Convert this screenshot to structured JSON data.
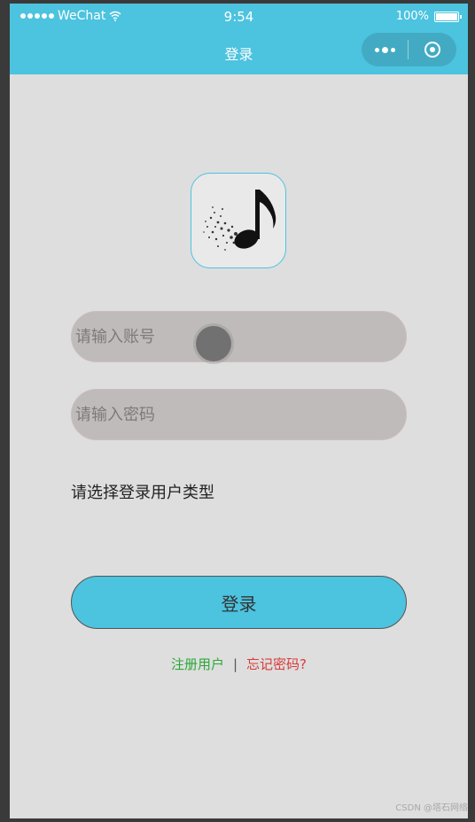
{
  "status_bar": {
    "carrier": "WeChat",
    "time": "9:54",
    "battery": "100%"
  },
  "nav": {
    "title": "登录"
  },
  "form": {
    "account_placeholder": "请输入账号",
    "password_placeholder": "请输入密码",
    "user_type_label": "请选择登录用户类型"
  },
  "login_button": "登录",
  "links": {
    "register": "注册用户",
    "separator": "|",
    "forgot": "忘记密码?"
  },
  "watermark": "CSDN @塔石网络",
  "colors": {
    "primary": "#4cc3df",
    "background": "#dedede",
    "input_bg": "#bfbbbb",
    "register_link": "#2aa838",
    "forgot_link": "#d93a3a"
  }
}
